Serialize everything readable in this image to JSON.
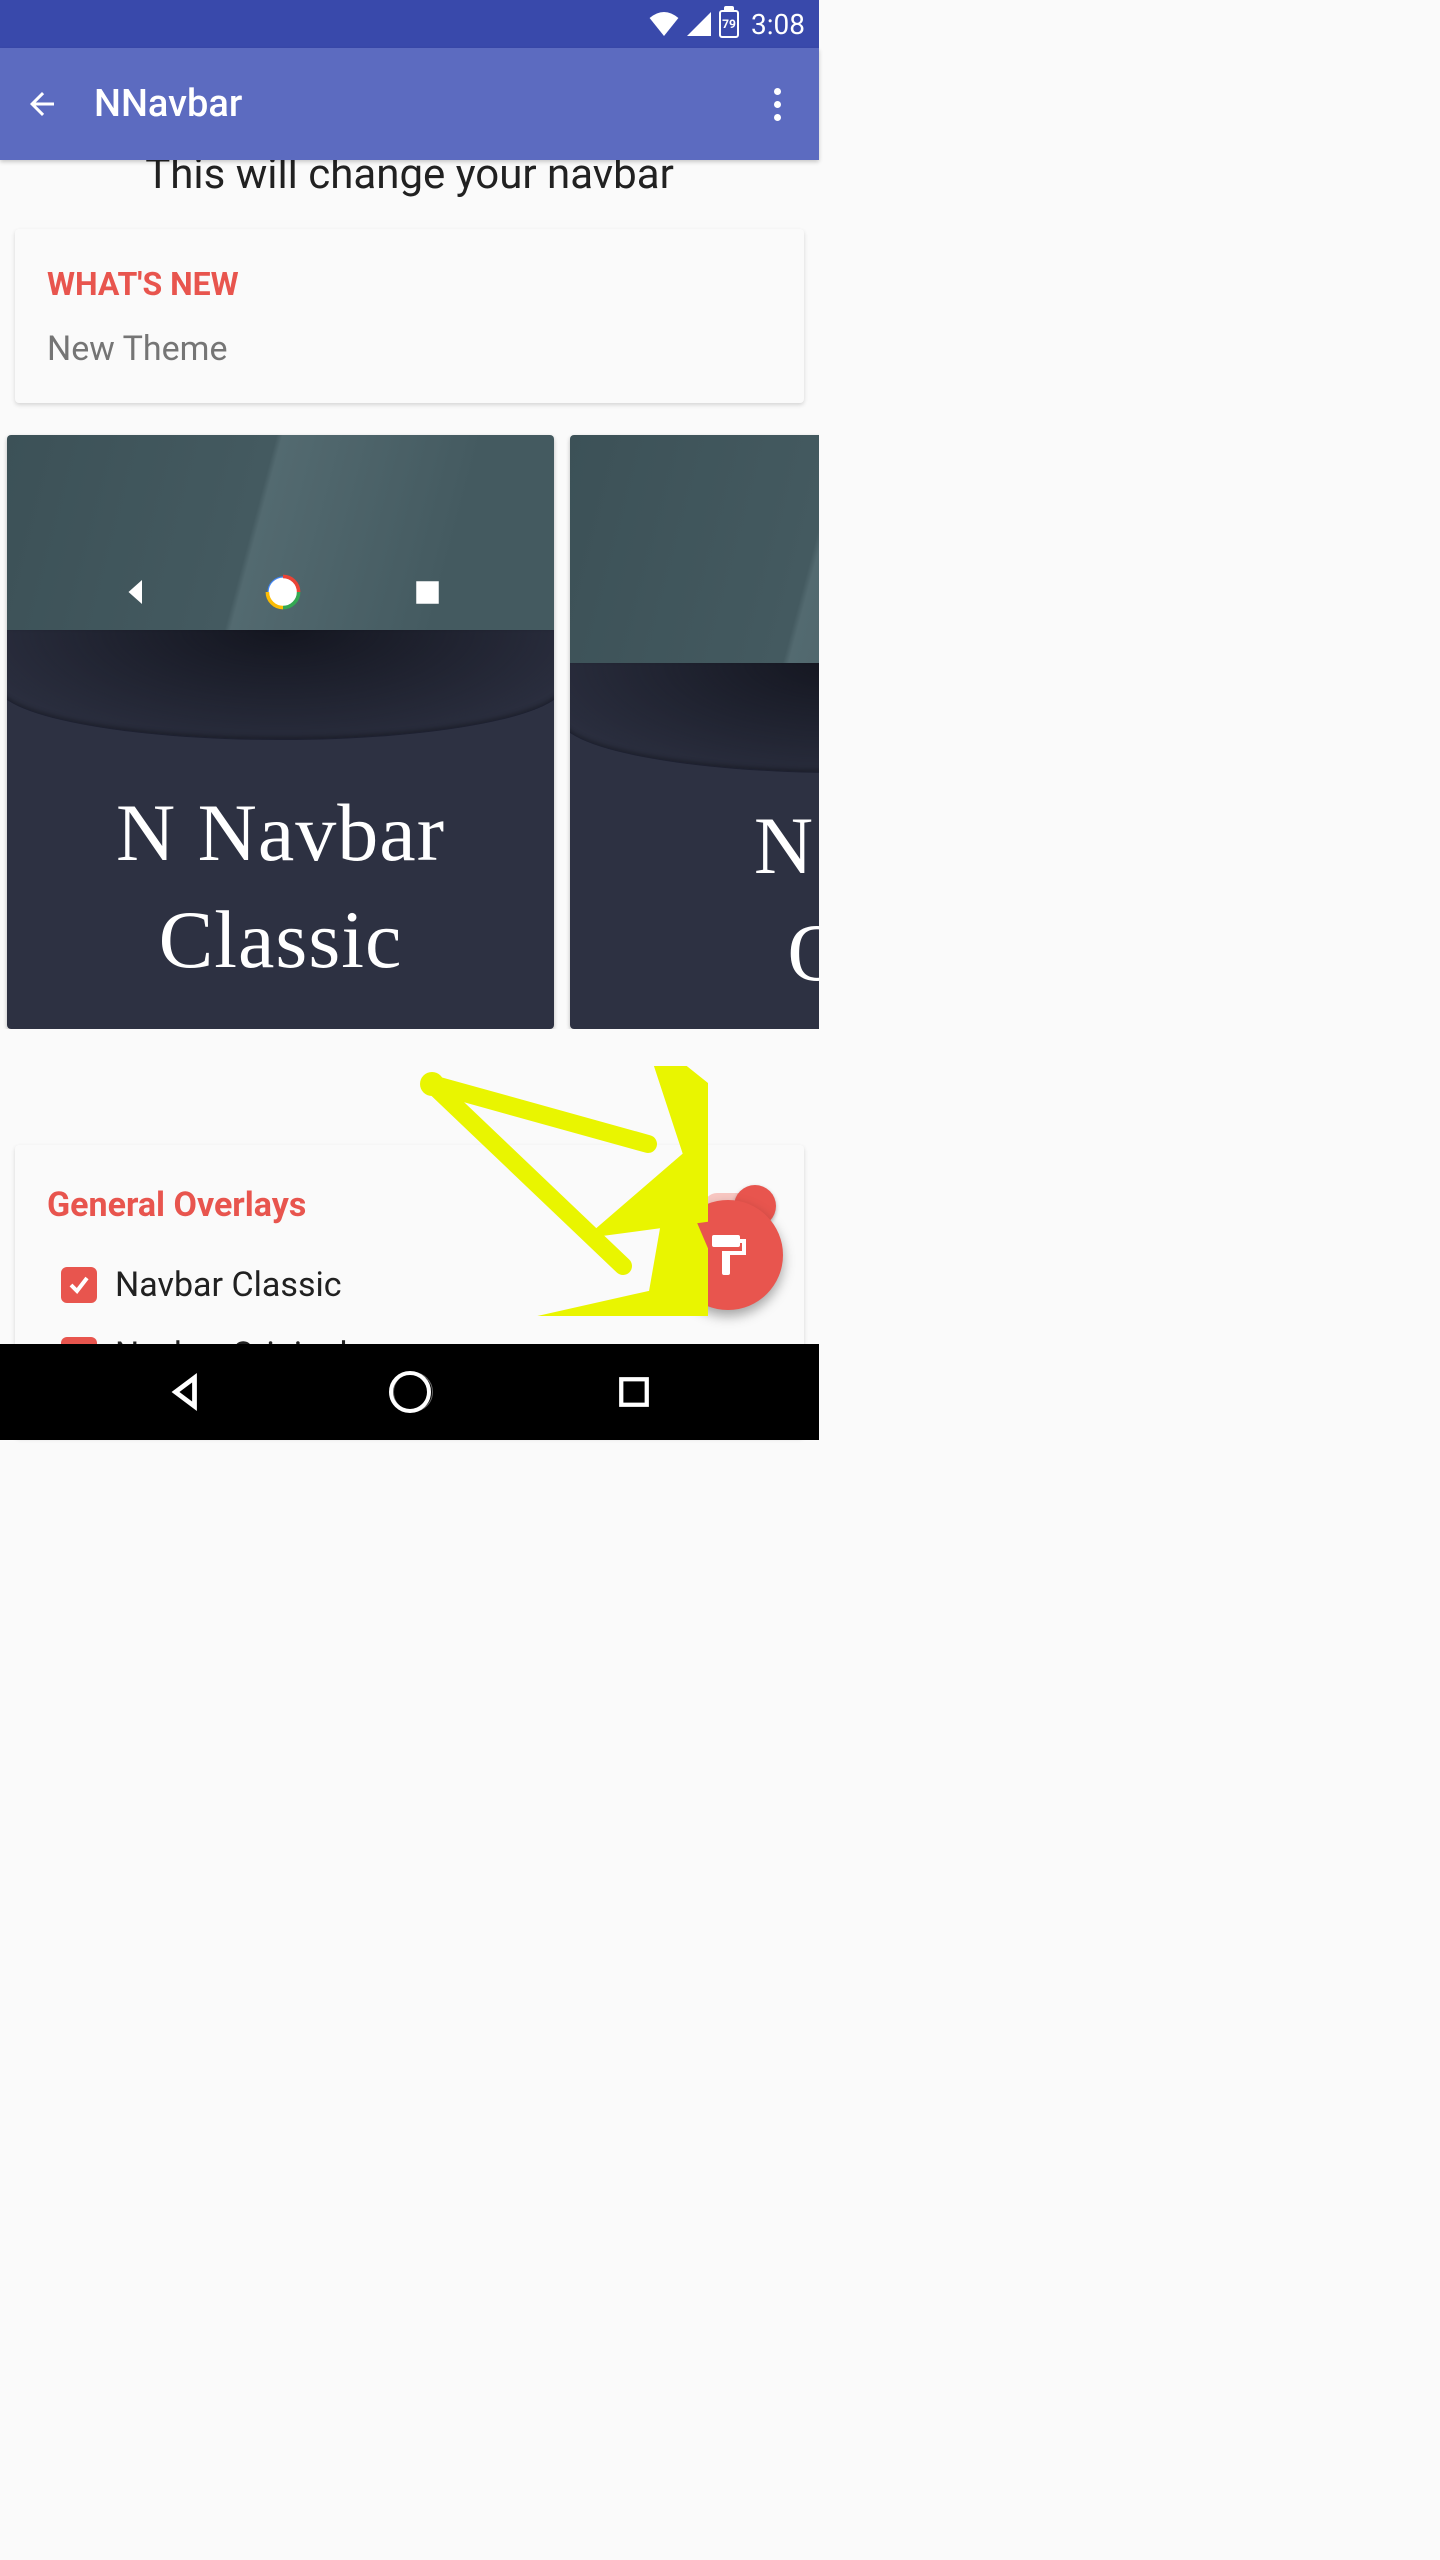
{
  "status": {
    "battery": "79",
    "time": "3:08"
  },
  "appbar": {
    "title": "NNavbar"
  },
  "heading": "This will change your navbar",
  "whats_new": {
    "title": "WHAT'S NEW",
    "text": "New Theme"
  },
  "themes": [
    {
      "line1": "N Navbar",
      "line2": "Classic"
    },
    {
      "line1": "N Na",
      "line2": "Ori"
    }
  ],
  "overlays": {
    "title": "General Overlays",
    "items": [
      {
        "label": "Navbar Classic",
        "checked": true
      },
      {
        "label": "Navbar Original",
        "checked": true
      }
    ]
  }
}
